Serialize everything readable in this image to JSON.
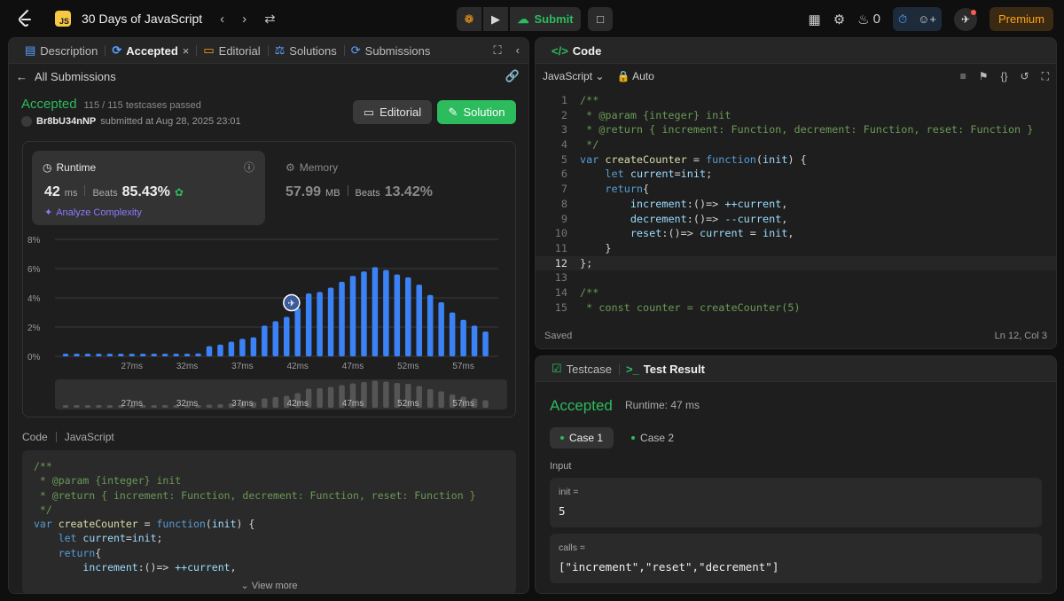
{
  "topbar": {
    "problem_badge": "JS",
    "problem_title": "30 Days of JavaScript",
    "submit_label": "Submit",
    "streak_count": "0",
    "premium_label": "Premium"
  },
  "left_tabs": [
    {
      "label": "Description"
    },
    {
      "label": "Accepted"
    },
    {
      "label": "Editorial"
    },
    {
      "label": "Solutions"
    },
    {
      "label": "Submissions"
    }
  ],
  "submission": {
    "back_label": "All Submissions",
    "status": "Accepted",
    "testcases": "115 / 115 testcases passed",
    "username": "Br8bU34nNP",
    "submitted_text": "submitted at Aug 28, 2025 23:01",
    "editorial_btn": "Editorial",
    "solution_btn": "Solution"
  },
  "runtime": {
    "label": "Runtime",
    "value": "42",
    "unit": "ms",
    "beats_label": "Beats",
    "beats_value": "85.43%",
    "analyze_label": "Analyze Complexity"
  },
  "memory": {
    "label": "Memory",
    "value": "57.99",
    "unit": "MB",
    "beats_label": "Beats",
    "beats_value": "13.42%"
  },
  "chart_data": {
    "type": "bar",
    "y_ticks": [
      "8%",
      "6%",
      "4%",
      "2%",
      "0%"
    ],
    "ylim": [
      0,
      8
    ],
    "x_tick_labels": [
      "27ms",
      "32ms",
      "37ms",
      "42ms",
      "47ms",
      "52ms",
      "57ms"
    ],
    "x_tick_positions": [
      27,
      32,
      37,
      42,
      47,
      52,
      57
    ],
    "x_start": 21,
    "x_step": 1,
    "values": [
      0.15,
      0.15,
      0.15,
      0.15,
      0.15,
      0.15,
      0.15,
      0.15,
      0.15,
      0.15,
      0.15,
      0.15,
      0.2,
      0.7,
      0.8,
      1.0,
      1.2,
      1.3,
      2.1,
      2.4,
      2.7,
      3.3,
      4.3,
      4.4,
      4.7,
      5.1,
      5.5,
      5.8,
      6.1,
      5.9,
      5.6,
      5.4,
      4.9,
      4.2,
      3.7,
      3.0,
      2.5,
      2.1,
      1.7
    ],
    "highlight_x": 42,
    "bar_color": "#3b82f6"
  },
  "left_code": {
    "header_label": "Code",
    "language": "JavaScript",
    "view_more": "View more",
    "lines": [
      [
        [
          "/**",
          "com"
        ]
      ],
      [
        [
          " * @param ",
          "com"
        ],
        [
          "{integer}",
          "com"
        ],
        [
          " init",
          "com"
        ]
      ],
      [
        [
          " * @return { increment: Function, decrement: Function, reset: Function }",
          "com"
        ]
      ],
      [
        [
          " */",
          "com"
        ]
      ],
      [
        [
          "var ",
          "kw"
        ],
        [
          "createCounter",
          "fn"
        ],
        [
          " = ",
          "plain"
        ],
        [
          "function",
          "kw"
        ],
        [
          "(",
          "plain"
        ],
        [
          "init",
          "var"
        ],
        [
          ") {",
          "plain"
        ]
      ],
      [
        [
          "    ",
          "plain"
        ],
        [
          "let ",
          "kw"
        ],
        [
          "current",
          "var"
        ],
        [
          "=",
          "plain"
        ],
        [
          "init",
          "var"
        ],
        [
          ";",
          "plain"
        ]
      ],
      [
        [
          "    ",
          "plain"
        ],
        [
          "return",
          "kw"
        ],
        [
          "{",
          "plain"
        ]
      ],
      [
        [
          "        ",
          "plain"
        ],
        [
          "increment",
          "var"
        ],
        [
          ":()=> ",
          "plain"
        ],
        [
          "++current",
          "var"
        ],
        [
          ",",
          "plain"
        ]
      ]
    ]
  },
  "code_panel": {
    "title": "Code",
    "language": "JavaScript",
    "auto_label": "Auto",
    "saved_label": "Saved",
    "cursor_pos": "Ln 12, Col 3",
    "current_line": 12,
    "lines": [
      {
        "n": "1",
        "t": [
          [
            "/**",
            "com"
          ]
        ]
      },
      {
        "n": "2",
        "t": [
          [
            " * @param {integer} init",
            "com"
          ]
        ]
      },
      {
        "n": "3",
        "t": [
          [
            " * @return { increment: Function, decrement: Function, reset: Function }",
            "com"
          ]
        ]
      },
      {
        "n": "4",
        "t": [
          [
            " */",
            "com"
          ]
        ]
      },
      {
        "n": "5",
        "t": [
          [
            "var ",
            "kw"
          ],
          [
            "createCounter",
            "fn"
          ],
          [
            " = ",
            "plain"
          ],
          [
            "function",
            "kw"
          ],
          [
            "(",
            "plain"
          ],
          [
            "init",
            "var"
          ],
          [
            ") {",
            "plain"
          ]
        ]
      },
      {
        "n": "6",
        "t": [
          [
            "    ",
            "plain"
          ],
          [
            "let ",
            "kw"
          ],
          [
            "current",
            "var"
          ],
          [
            "=",
            "plain"
          ],
          [
            "init",
            "var"
          ],
          [
            ";",
            "plain"
          ]
        ]
      },
      {
        "n": "7",
        "t": [
          [
            "    ",
            "plain"
          ],
          [
            "return",
            "kw"
          ],
          [
            "{",
            "plain"
          ]
        ]
      },
      {
        "n": "8",
        "t": [
          [
            "        ",
            "plain"
          ],
          [
            "increment",
            "var"
          ],
          [
            ":()=> ",
            "plain"
          ],
          [
            "++current",
            "var"
          ],
          [
            ",",
            "plain"
          ]
        ]
      },
      {
        "n": "9",
        "t": [
          [
            "        ",
            "plain"
          ],
          [
            "decrement",
            "var"
          ],
          [
            ":()=> ",
            "plain"
          ],
          [
            "--current",
            "var"
          ],
          [
            ",",
            "plain"
          ]
        ]
      },
      {
        "n": "10",
        "t": [
          [
            "        ",
            "plain"
          ],
          [
            "reset",
            "var"
          ],
          [
            ":()=> ",
            "plain"
          ],
          [
            "current",
            "var"
          ],
          [
            " = ",
            "plain"
          ],
          [
            "init",
            "var"
          ],
          [
            ",",
            "plain"
          ]
        ]
      },
      {
        "n": "11",
        "t": [
          [
            "    }",
            "plain"
          ]
        ]
      },
      {
        "n": "12",
        "t": [
          [
            "};",
            "plain"
          ]
        ]
      },
      {
        "n": "13",
        "t": [
          [
            "",
            "plain"
          ]
        ]
      },
      {
        "n": "14",
        "t": [
          [
            "/**",
            "com"
          ]
        ]
      },
      {
        "n": "15",
        "t": [
          [
            " * const counter = createCounter(5)",
            "com"
          ]
        ]
      }
    ]
  },
  "test_panel": {
    "testcase_tab": "Testcase",
    "result_tab": "Test Result",
    "status": "Accepted",
    "runtime": "Runtime: 47 ms",
    "cases": [
      "Case 1",
      "Case 2"
    ],
    "input_label": "Input",
    "inputs": [
      {
        "name": "init =",
        "value": "5"
      },
      {
        "name": "calls =",
        "value": "[\"increment\",\"reset\",\"decrement\"]"
      }
    ]
  }
}
